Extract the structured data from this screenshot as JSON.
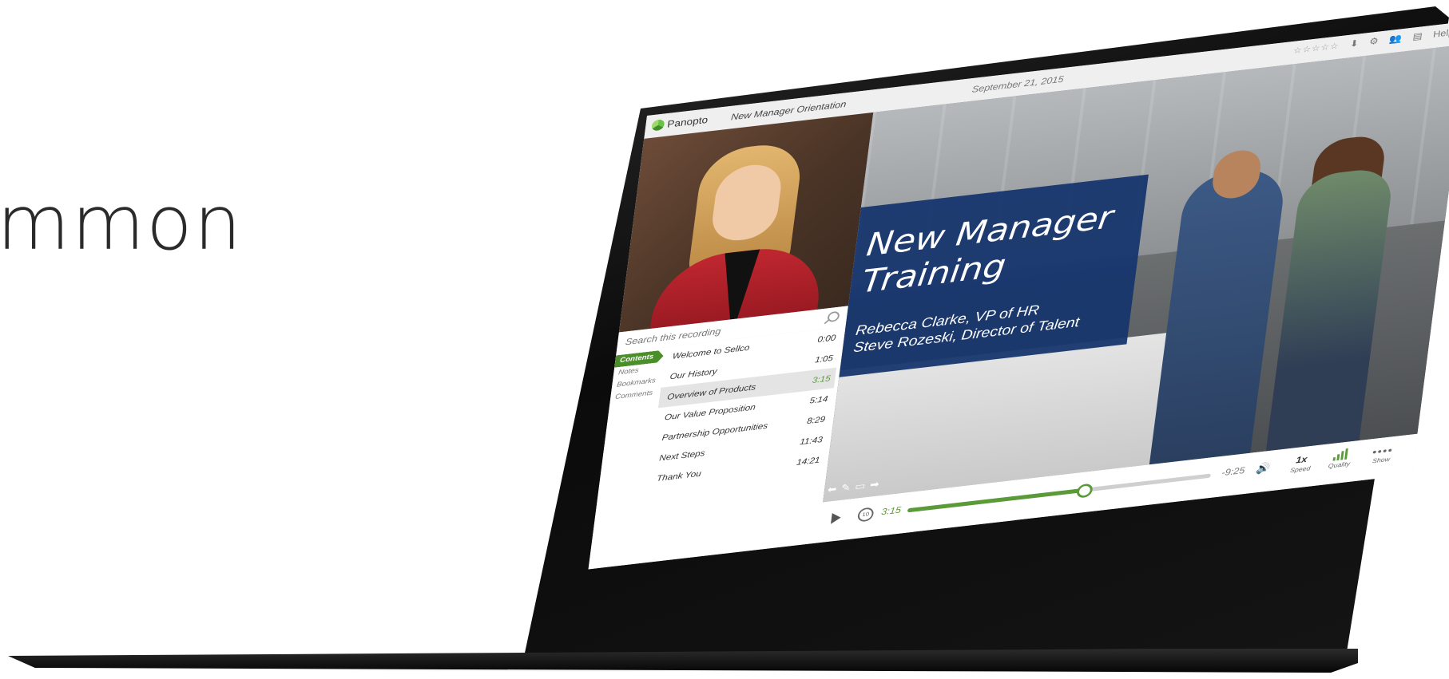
{
  "hero": {
    "headline_fragment": "mmon"
  },
  "app": {
    "brand": "Panopto",
    "recording_title": "New Manager Orientation",
    "recording_date": "September 21, 2015",
    "toolbar": {
      "rating_stars": "☆☆☆☆☆",
      "icons": [
        "download-icon",
        "settings-icon",
        "users-icon",
        "layout-icon"
      ],
      "help_label": "Help ▾"
    },
    "search": {
      "placeholder": "Search this recording"
    },
    "side_tabs": [
      "Contents",
      "Notes",
      "Bookmarks",
      "Comments"
    ],
    "active_tab": "Contents",
    "contents": [
      {
        "title": "Welcome to Sellco",
        "time": "0:00"
      },
      {
        "title": "Our History",
        "time": "1:05"
      },
      {
        "title": "Overview of Products",
        "time": "3:15",
        "current": true
      },
      {
        "title": "Our Value Proposition",
        "time": "5:14"
      },
      {
        "title": "Partnership Opportunities",
        "time": "8:29"
      },
      {
        "title": "Next Steps",
        "time": "11:43"
      },
      {
        "title": "Thank You",
        "time": "14:21"
      }
    ],
    "slide": {
      "title": "New Manager Training",
      "title_line1": "New Manager",
      "title_line2": "Training",
      "presenter1": "Rebecca Clarke, VP of HR",
      "presenter2": "Steve Rozeski, Director of Talent"
    },
    "player": {
      "elapsed": "3:15",
      "remaining": "-9:25",
      "progress_fraction": 0.58,
      "speed_value": "1x",
      "speed_label": "Speed",
      "quality_label": "Quality",
      "show_label": "Show"
    },
    "colors": {
      "accent_green": "#5a9a38",
      "slide_blue": "#17366e"
    }
  }
}
